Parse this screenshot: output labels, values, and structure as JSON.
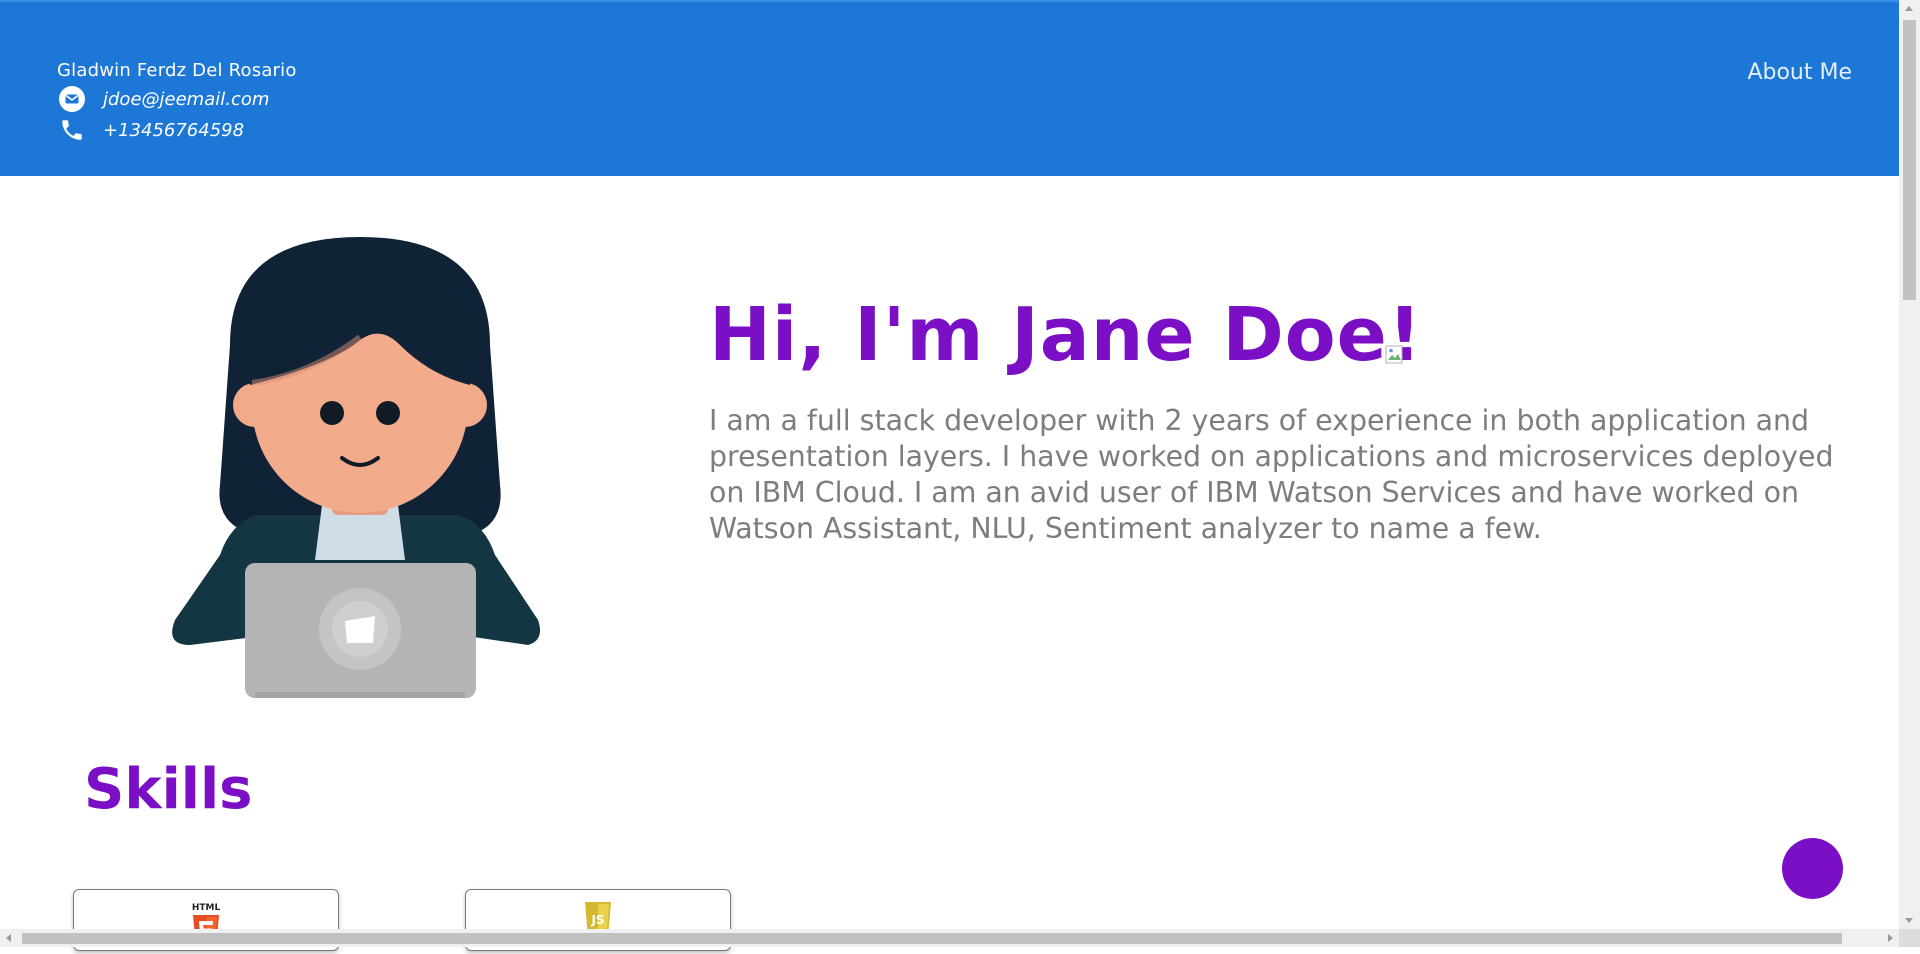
{
  "header": {
    "name": "Gladwin Ferdz Del Rosario",
    "email": "jdoe@jeemail.com",
    "phone": "+13456764598",
    "nav_about": "About Me",
    "background": "#1c77d6"
  },
  "hero": {
    "title": "Hi, I'm Jane Doe!",
    "description": "I am a full stack developer with 2 years of experience in both application and presentation layers. I have worked on applications and microservices deployed on IBM Cloud. I am an avid user of IBM Watson Services and have worked on Watson Assistant, NLU, Sentiment analyzer to name a few.",
    "accent": "#7a0fc6",
    "text_color": "#7d7d7d"
  },
  "skills": {
    "title": "Skills",
    "cards": [
      {
        "icon": "html5-icon",
        "label": "HTML"
      },
      {
        "icon": "javascript-icon",
        "label": "JS"
      }
    ]
  },
  "icons": {
    "email": "envelope-icon",
    "phone": "phone-icon",
    "broken_image": "broken-image-icon",
    "avatar": "developer-avatar-illustration"
  }
}
